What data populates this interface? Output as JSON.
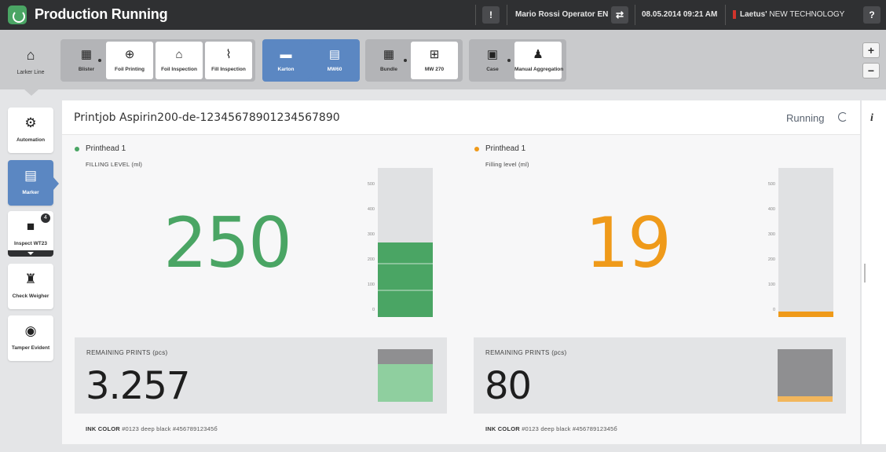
{
  "app": {
    "title": "Production Running"
  },
  "topbar": {
    "help_glyph": "!",
    "user": "Mario Rossi Operator EN",
    "datetime": "08.05.2014 09:21 AM",
    "brand_bold": "Laetus'",
    "brand_rest": "NEW TECHNOLOGY",
    "question_glyph": "?"
  },
  "toolbar": {
    "home": {
      "label": "Larker Line",
      "icon": "home-icon",
      "glyph": "⌂"
    },
    "tools": [
      {
        "label": "Blister",
        "icon": "blister-icon",
        "glyph": "▦"
      },
      {
        "label": "Foil Printing",
        "icon": "foil-printing-icon",
        "glyph": "⊕"
      },
      {
        "label": "Foil Inspection",
        "icon": "foil-inspection-icon",
        "glyph": "⌂"
      },
      {
        "label": "Fill Inspection",
        "icon": "fill-inspection-icon",
        "glyph": "⌇"
      },
      {
        "label": "Karton",
        "icon": "karton-icon",
        "glyph": "▬"
      },
      {
        "label": "MW60",
        "icon": "mw60-icon",
        "glyph": "▤"
      },
      {
        "label": "Bundle",
        "icon": "bundle-icon",
        "glyph": "▦"
      },
      {
        "label": "MW 270",
        "icon": "mw270-icon",
        "glyph": "⊞"
      },
      {
        "label": "Case",
        "icon": "case-icon",
        "glyph": "▣"
      },
      {
        "label": "Manual Aggregation",
        "icon": "manual-aggregation-icon",
        "glyph": "♟"
      }
    ],
    "zoom_in": "+",
    "zoom_out": "−"
  },
  "sidebar": {
    "items": [
      {
        "label": "Automation",
        "icon": "gears-icon",
        "glyph": "⚙"
      },
      {
        "label": "Marker",
        "icon": "marker-icon",
        "glyph": "▤"
      },
      {
        "label": "Inspect WT23",
        "icon": "camera-icon",
        "glyph": "■"
      },
      {
        "label": "Check Weigher",
        "icon": "scale-icon",
        "glyph": "♜"
      },
      {
        "label": "Tamper Evident",
        "icon": "eye-icon",
        "glyph": "◉"
      }
    ],
    "badge": "4"
  },
  "printjob": {
    "title": "Printjob Aspirin200-de-12345678901234567890",
    "status": "Running",
    "info": "i"
  },
  "printheads": [
    {
      "name": "Printhead 1",
      "status_color": "#4aa564",
      "level_label": "FILLING LEVEL (ml)",
      "level_value": "250",
      "level_ml": 250,
      "value_color": "#4aa564",
      "ticks": [
        "500",
        "400",
        "300",
        "200",
        "100",
        "0"
      ],
      "gauge_max": 500,
      "remaining_label": "REMAINING PRINTS (pcs)",
      "remaining_value": "3.257",
      "cartridge_fill": 0.71,
      "cartridge_color": "#8fcf9f",
      "ink_label": "INK COLOR",
      "ink_value": "#0123 deep black #45678912345б"
    },
    {
      "name": "Printhead 1",
      "status_color": "#ef9a1a",
      "level_label": "Filling level (ml)",
      "level_value": "19",
      "level_ml": 19,
      "value_color": "#ef9a1a",
      "ticks": [
        "500",
        "400",
        "300",
        "200",
        "100",
        "0"
      ],
      "gauge_max": 500,
      "remaining_label": "REMAINING PRINTS (pcs)",
      "remaining_value": "80",
      "cartridge_fill": 0.1,
      "cartridge_color": "#f2b65c",
      "ink_label": "INK COLOR",
      "ink_value": "#0123 deep black #45678912345б"
    }
  ]
}
